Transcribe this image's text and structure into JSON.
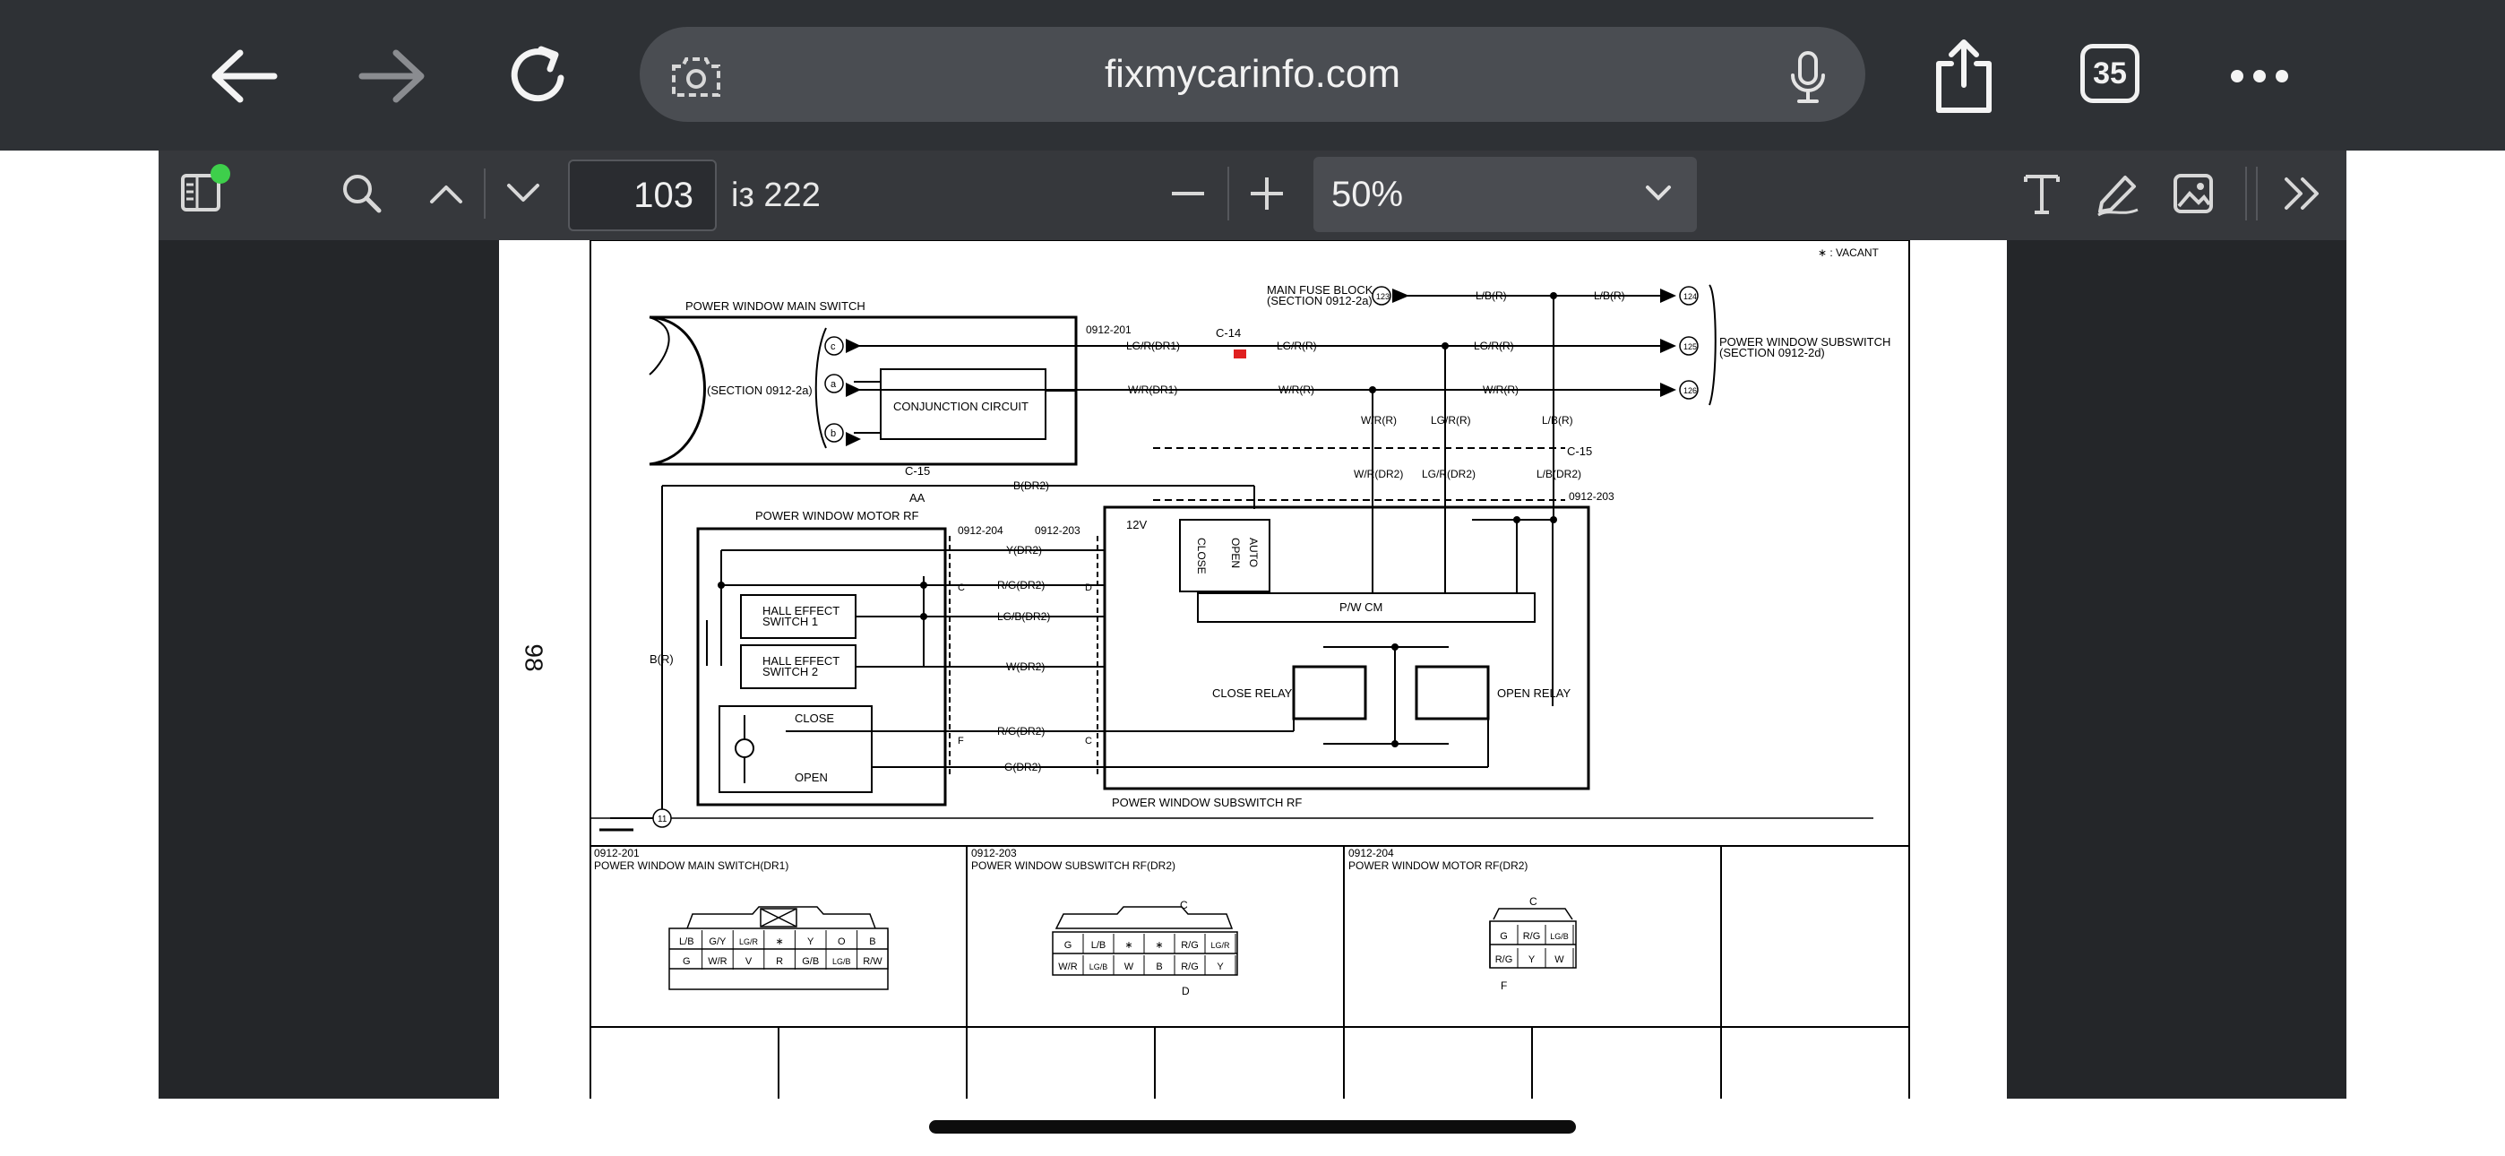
{
  "browser": {
    "url": "fixmycarinfo.com",
    "tab_count": "35",
    "icons": [
      "back-arrow-icon",
      "forward-arrow-icon",
      "reload-icon",
      "camera-search-icon",
      "microphone-icon",
      "share-icon",
      "more-dots-icon"
    ]
  },
  "pdf_toolbar": {
    "current_page": "103",
    "total_pages": "із 222",
    "zoom": "50%",
    "icons": [
      "sidebar-icon",
      "search-icon",
      "chevron-up-icon",
      "chevron-down-icon",
      "zoom-out-icon",
      "zoom-in-icon",
      "text-tool-icon",
      "pen-tool-icon",
      "image-tool-icon",
      "more-tools-icon"
    ],
    "colors": {
      "badge": "#3ecf4b"
    }
  },
  "document": {
    "side_page_number": "98",
    "vacant_note": "∗ : VACANT",
    "labels": {
      "main_switch": "POWER WINDOW MAIN SWITCH",
      "section_2a": "(SECTION 0912-2a)",
      "conjunction": "CONJUNCTION CIRCUIT",
      "fuse_block_1": "MAIN FUSE BLOCK",
      "fuse_block_2": "(SECTION 0912-2a)",
      "subswitch_1": "POWER WINDOW SUBSWITCH",
      "subswitch_2": "(SECTION 0912-2d)",
      "conn_201": "0912-201",
      "conn_203": "0912-203",
      "conn_204": "0912-204",
      "c14": "C-14",
      "c15": "C-15",
      "c15b": "C-15",
      "aa": "AA",
      "motor_rf": "POWER WINDOW MOTOR RF",
      "subswitch_rf": "POWER WINDOW SUBSWITCH RF",
      "hall1a": "HALL EFFECT",
      "hall1b": "SWITCH 1",
      "hall2a": "HALL EFFECT",
      "hall2b": "SWITCH 2",
      "close": "CLOSE",
      "open": "OPEN",
      "pwcm": "P/W CM",
      "close_relay": "CLOSE RELAY",
      "open_relay": "OPEN RELAY",
      "v12": "12V",
      "sw_close": "CLOSE",
      "sw_open": "OPEN",
      "sw_auto": "AUTO",
      "br": "B(R)",
      "pin_c": "c",
      "pin_a": "a",
      "pin_b": "b",
      "t123": "123",
      "t124": "124",
      "t125": "125",
      "t126": "126",
      "t11": "11"
    },
    "wires": {
      "lbr1": "L/B(R)",
      "lbr2": "L/B(R)",
      "lgr_dr1": "LG/R(DR1)",
      "lgr1": "LG/R(R)",
      "lgr2": "LG/R(R)",
      "wr_dr1": "W/R(DR1)",
      "wr1": "W/R(R)",
      "wr2": "W/R(R)",
      "wr_v": "W/R(R)",
      "lgr_v": "LG/R(R)",
      "lbr_v": "L/B(R)",
      "wr_dr2": "W/R(DR2)",
      "lgr_dr2": "LG/R(DR2)",
      "lb_dr2": "L/B(DR2)",
      "b_dr2": "B(DR2)",
      "y_dr2": "Y(DR2)",
      "rg_dr2a": "R/G(DR2)",
      "lgb_dr2": "LG/B(DR2)",
      "w_dr2": "W(DR2)",
      "rg_dr2b": "R/G(DR2)",
      "g_dr2": "G(DR2)",
      "pin_C": "C",
      "pin_D": "D",
      "pin_F": "F",
      "pin_C2": "C"
    },
    "connectors": {
      "c201": {
        "code": "0912-201",
        "title": "POWER WINDOW MAIN SWITCH(DR1)",
        "row1": [
          "L/B",
          "G/Y",
          "LG/R",
          "∗",
          "Y",
          "O",
          "B"
        ],
        "row2": [
          "G",
          "W/R",
          "V",
          "R",
          "G/B",
          "LG/B",
          "R/W"
        ]
      },
      "c203": {
        "code": "0912-203",
        "title": "POWER WINDOW SUBSWITCH RF(DR2)",
        "top": "C",
        "bottom": "D",
        "row1": [
          "G",
          "L/B",
          "∗",
          "∗",
          "R/G",
          "LG/R"
        ],
        "row2": [
          "W/R",
          "LG/B",
          "W",
          "B",
          "R/G",
          "Y"
        ]
      },
      "c204": {
        "code": "0912-204",
        "title": "POWER WINDOW MOTOR RF(DR2)",
        "top": "C",
        "bottom": "F",
        "row1": [
          "G",
          "R/G",
          "LG/B"
        ],
        "row2": [
          "R/G",
          "Y",
          "W"
        ]
      }
    }
  }
}
